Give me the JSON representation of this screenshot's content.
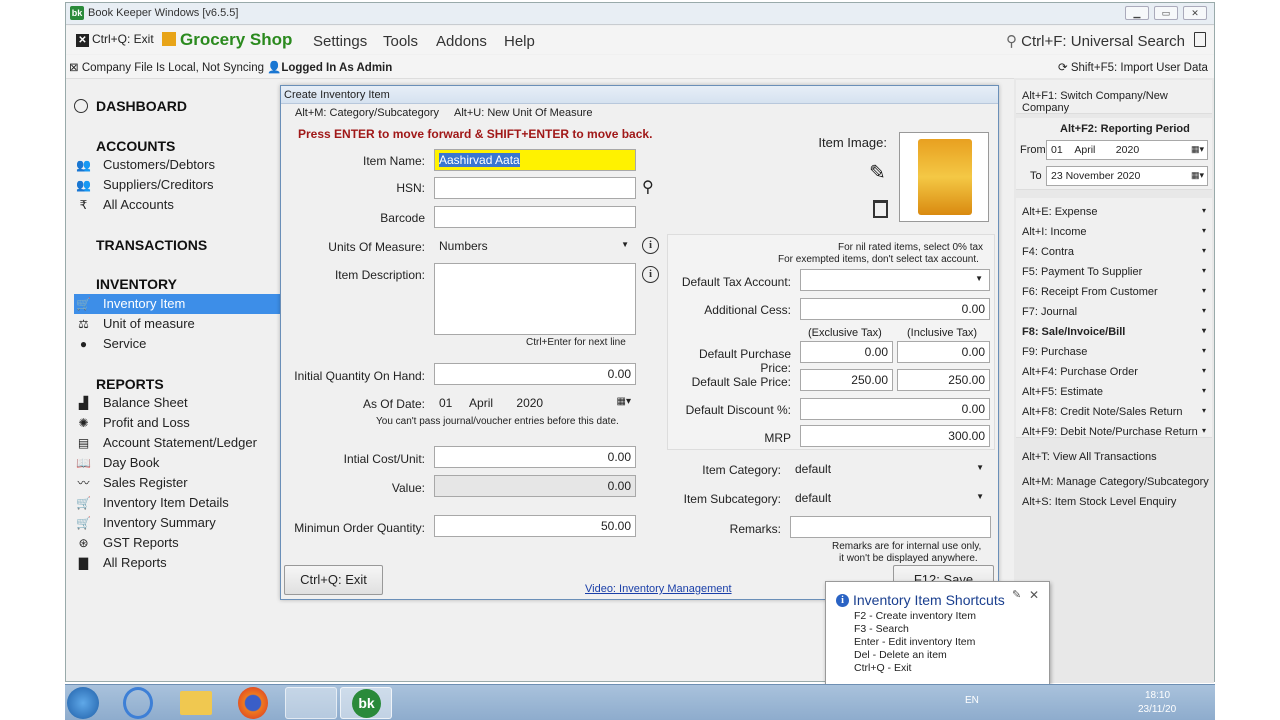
{
  "window": {
    "title": "Book Keeper Windows [v6.5.5]",
    "logo": "bk"
  },
  "menubar": {
    "exit": "Ctrl+Q: Exit",
    "company": "Grocery Shop",
    "items": [
      "Settings",
      "Tools",
      "Addons",
      "Help"
    ],
    "universal_search": "Ctrl+F: Universal Search"
  },
  "statusbar": {
    "sync": "Company File Is Local, Not Syncing",
    "login": "Logged In As Admin",
    "import": "Shift+F5: Import User Data"
  },
  "sidebar": {
    "dashboard": "DASHBOARD",
    "accounts_header": "ACCOUNTS",
    "accounts": [
      "Customers/Debtors",
      "Suppliers/Creditors",
      "All Accounts"
    ],
    "transactions_header": "TRANSACTIONS",
    "inventory_header": "INVENTORY",
    "inventory": [
      "Inventory Item",
      "Unit of measure",
      "Service"
    ],
    "reports_header": "REPORTS",
    "reports": [
      "Balance Sheet",
      "Profit and Loss",
      "Account Statement/Ledger",
      "Day Book",
      "Sales Register",
      "Inventory Item Details",
      "Inventory Summary",
      "GST Reports",
      "All Reports"
    ]
  },
  "dialog": {
    "title": "Create Inventory Item",
    "toolbar": [
      "Alt+M: Category/Subcategory",
      "Alt+U: New Unit Of Measure"
    ],
    "hint": "Press ENTER to move forward & SHIFT+ENTER to move back.",
    "labels": {
      "item_name": "Item Name:",
      "hsn": "HSN:",
      "barcode": "Barcode",
      "uom": "Units Of Measure:",
      "description": "Item Description:",
      "desc_hint": "Ctrl+Enter for next line",
      "initial_qty": "Initial Quantity On Hand:",
      "as_of_date": "As Of Date:",
      "date_note": "You can't pass journal/voucher entries before this date.",
      "initial_cost": "Intial Cost/Unit:",
      "value": "Value:",
      "min_order": "Minimun Order Quantity:",
      "item_image": "Item Image:",
      "tax_note1": "For nil rated items, select 0% tax",
      "tax_note2": "For exempted items, don't select tax account.",
      "tax_account": "Default Tax Account:",
      "cess": "Additional Cess:",
      "exclusive": "(Exclusive Tax)",
      "inclusive": "(Inclusive Tax)",
      "purchase_price": "Default Purchase Price:",
      "sale_price": "Default Sale Price:",
      "discount": "Default Discount %:",
      "mrp": "MRP",
      "category": "Item Category:",
      "subcategory": "Item Subcategory:",
      "remarks": "Remarks:",
      "remarks_note1": "Remarks are for internal use only,",
      "remarks_note2": "it won't be displayed anywhere."
    },
    "values": {
      "item_name": "Aashirvad Aata",
      "hsn": "",
      "barcode": "",
      "uom": "Numbers",
      "description": "",
      "initial_qty": "0.00",
      "date_day": "01",
      "date_month": "April",
      "date_year": "2020",
      "initial_cost": "0.00",
      "value": "0.00",
      "min_order": "50.00",
      "tax_account": "",
      "cess": "0.00",
      "purchase_excl": "0.00",
      "purchase_incl": "0.00",
      "sale_excl": "250.00",
      "sale_incl": "250.00",
      "discount": "0.00",
      "mrp": "300.00",
      "category": "default",
      "subcategory": "default",
      "remarks": ""
    },
    "exit_button": "Ctrl+Q: Exit",
    "save_button": "F12: Save",
    "video_link": "Video: Inventory Management"
  },
  "rightpanel": {
    "switch_company": "Alt+F1: Switch Company/New Company",
    "period_title": "Alt+F2: Reporting Period",
    "from_label": "From",
    "from_day": "01",
    "from_month": "April",
    "from_year": "2020",
    "to_label": "To",
    "to_date": "23 November 2020",
    "shortcuts": [
      "Alt+E: Expense",
      "Alt+I: Income",
      "F4: Contra",
      "F5: Payment To Supplier",
      "F6: Receipt From Customer",
      "F7: Journal",
      "F8: Sale/Invoice/Bill",
      "F9: Purchase",
      "Alt+F4: Purchase Order",
      "Alt+F5: Estimate",
      "Alt+F8: Credit Note/Sales Return",
      "Alt+F9: Debit Note/Purchase Return"
    ],
    "links": [
      "Alt+T: View All Transactions",
      "Alt+M: Manage Category/Subcategory",
      "Alt+S: Item Stock Level Enquiry"
    ]
  },
  "popup": {
    "title": "Inventory Item Shortcuts",
    "lines": [
      "F2 - Create inventory Item",
      "F3 - Search",
      "Enter - Edit inventory Item",
      "Del - Delete an item",
      "Ctrl+Q - Exit"
    ]
  },
  "taskbar": {
    "lang": "EN",
    "time": "18:10",
    "date": "23/11/20"
  }
}
